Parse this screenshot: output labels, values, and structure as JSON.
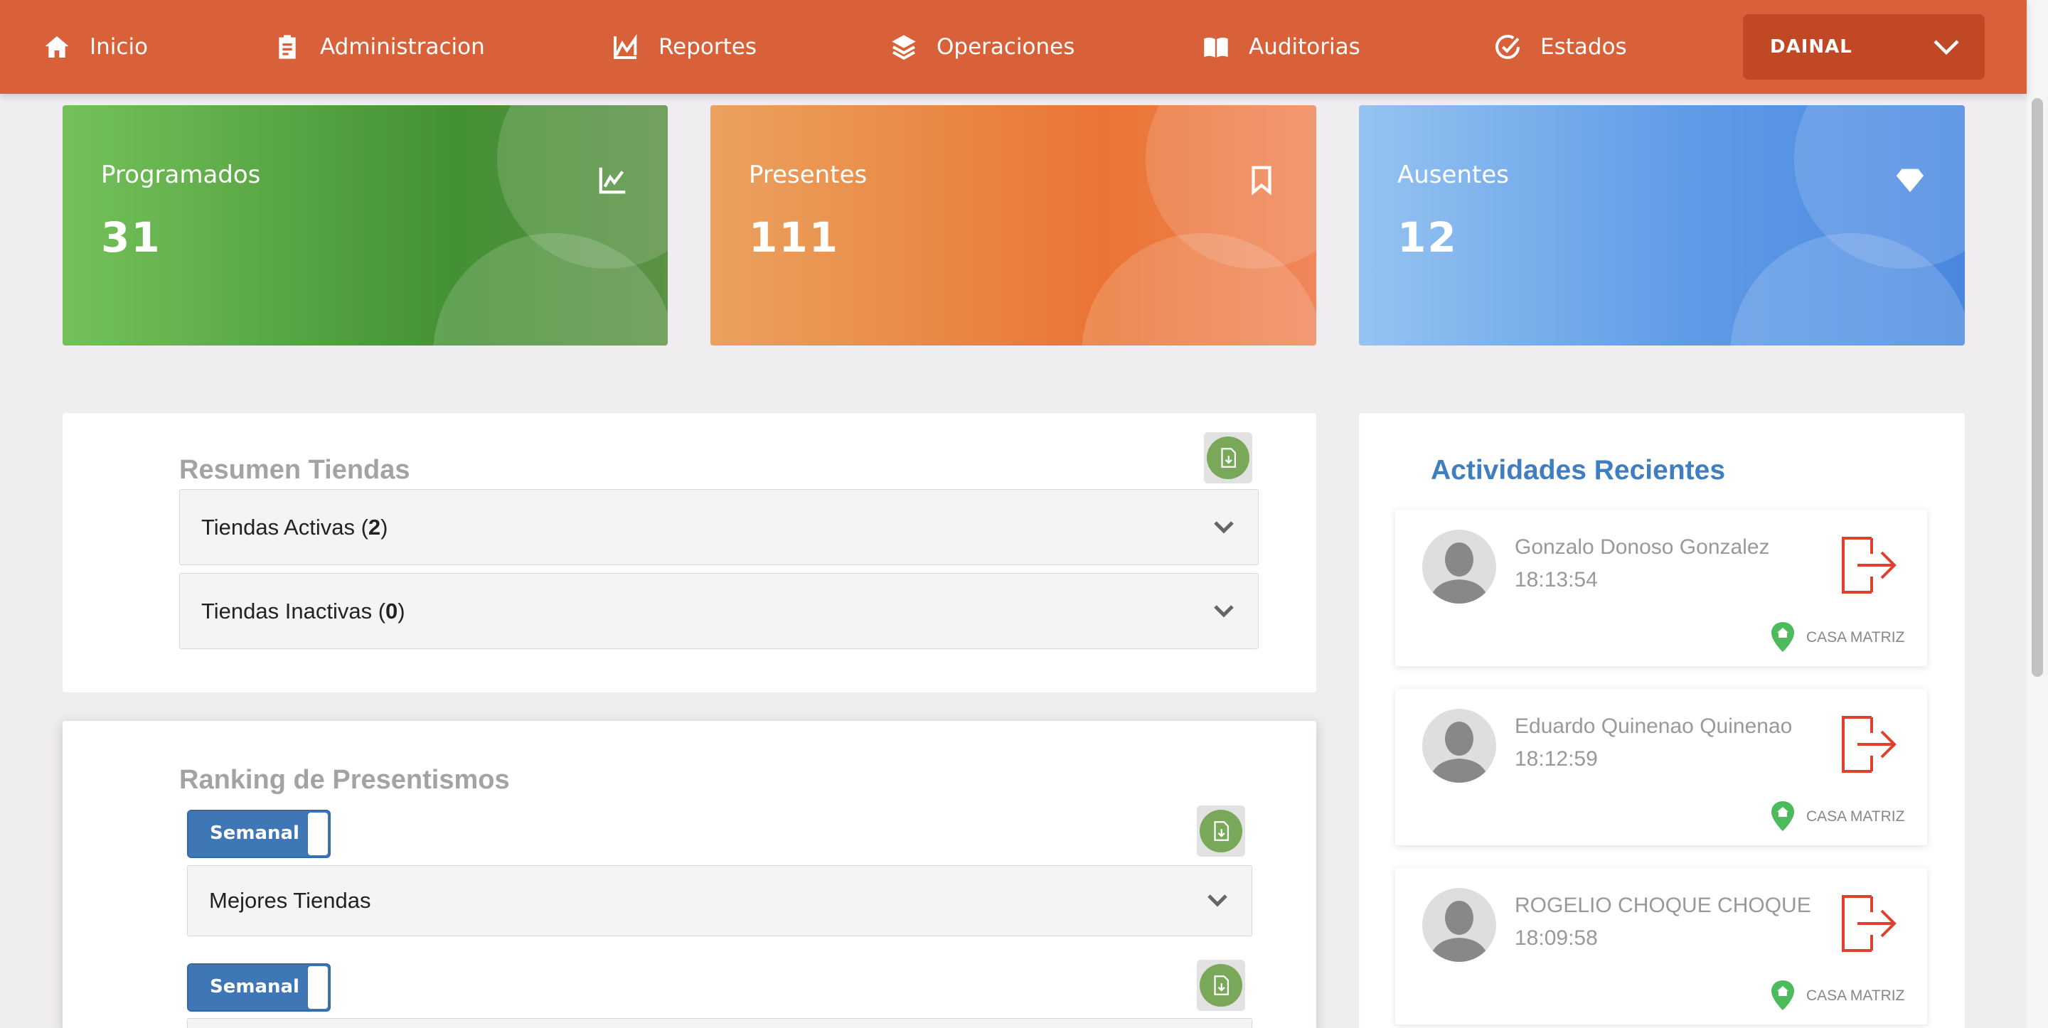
{
  "nav": {
    "items": [
      {
        "label": "Inicio",
        "icon": "home-icon"
      },
      {
        "label": "Administracion",
        "icon": "clipboard-icon"
      },
      {
        "label": "Reportes",
        "icon": "chart-area-icon"
      },
      {
        "label": "Operaciones",
        "icon": "layers-icon"
      },
      {
        "label": "Auditorias",
        "icon": "book-open-icon"
      },
      {
        "label": "Estados",
        "icon": "check-circle-icon"
      }
    ],
    "user": "DAINAL"
  },
  "stats": [
    {
      "label": "Programados",
      "value": "31",
      "icon": "line-chart-icon",
      "color": "#449034"
    },
    {
      "label": "Presentes",
      "value": "111",
      "icon": "bookmark-icon",
      "color": "#ea7434"
    },
    {
      "label": "Ausentes",
      "value": "12",
      "icon": "diamond-icon",
      "color": "#4a88e0"
    }
  ],
  "resumen": {
    "title": "Resumen Tiendas",
    "activas_label": "Tiendas Activas (",
    "activas_count": "2",
    "inactivas_label": "Tiendas Inactivas (",
    "inactivas_count": "0",
    "close_paren": ")"
  },
  "ranking": {
    "title": "Ranking de Presentismos",
    "toggle_label": "Semanal",
    "mejores_label": "Mejores Tiendas"
  },
  "actividades": {
    "title": "Actividades Recientes",
    "items": [
      {
        "name": "Gonzalo Donoso Gonzalez",
        "time": "18:13:54",
        "location": "CASA MATRIZ"
      },
      {
        "name": "Eduardo Quinenao Quinenao",
        "time": "18:12:59",
        "location": "CASA MATRIZ"
      },
      {
        "name": "ROGELIO CHOQUE CHOQUE",
        "time": "18:09:58",
        "location": "CASA MATRIZ"
      }
    ]
  },
  "colors": {
    "nav": "#d8613a",
    "accent_blue": "#3f7ec0",
    "exit_red": "#e0402e",
    "pin_green": "#4cbb5c"
  }
}
